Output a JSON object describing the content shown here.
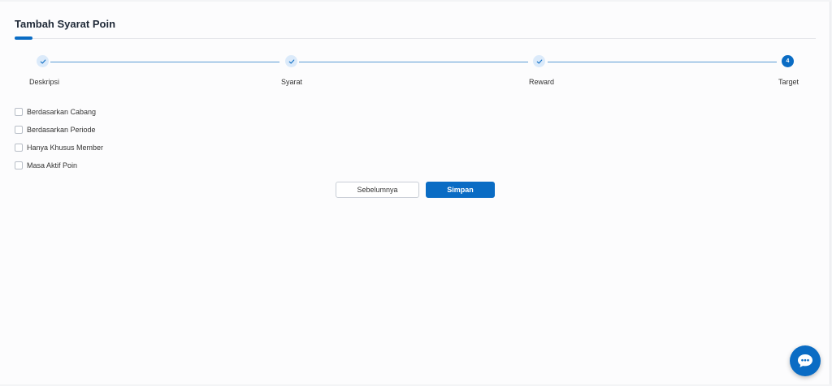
{
  "page": {
    "title": "Tambah Syarat Poin"
  },
  "stepper": {
    "steps": [
      {
        "label": "Deskripsi",
        "status": "done",
        "icon": "check-icon"
      },
      {
        "label": "Syarat",
        "status": "done",
        "icon": "check-icon"
      },
      {
        "label": "Reward",
        "status": "done",
        "icon": "check-icon"
      },
      {
        "label": "Target",
        "status": "active",
        "number": "4"
      }
    ]
  },
  "options": [
    {
      "label": "Berdasarkan Cabang",
      "checked": false
    },
    {
      "label": "Berdasarkan Periode",
      "checked": false
    },
    {
      "label": "Hanya Khusus Member",
      "checked": false
    },
    {
      "label": "Masa Aktif Poin",
      "checked": false
    }
  ],
  "actions": {
    "prev_label": "Sebelumnya",
    "save_label": "Simpan"
  },
  "chat": {
    "icon": "chat-bubble-icon"
  },
  "colors": {
    "primary": "#0a6cc4",
    "step_done_bg": "#dbeafa",
    "step_line": "#5a9bd5"
  }
}
